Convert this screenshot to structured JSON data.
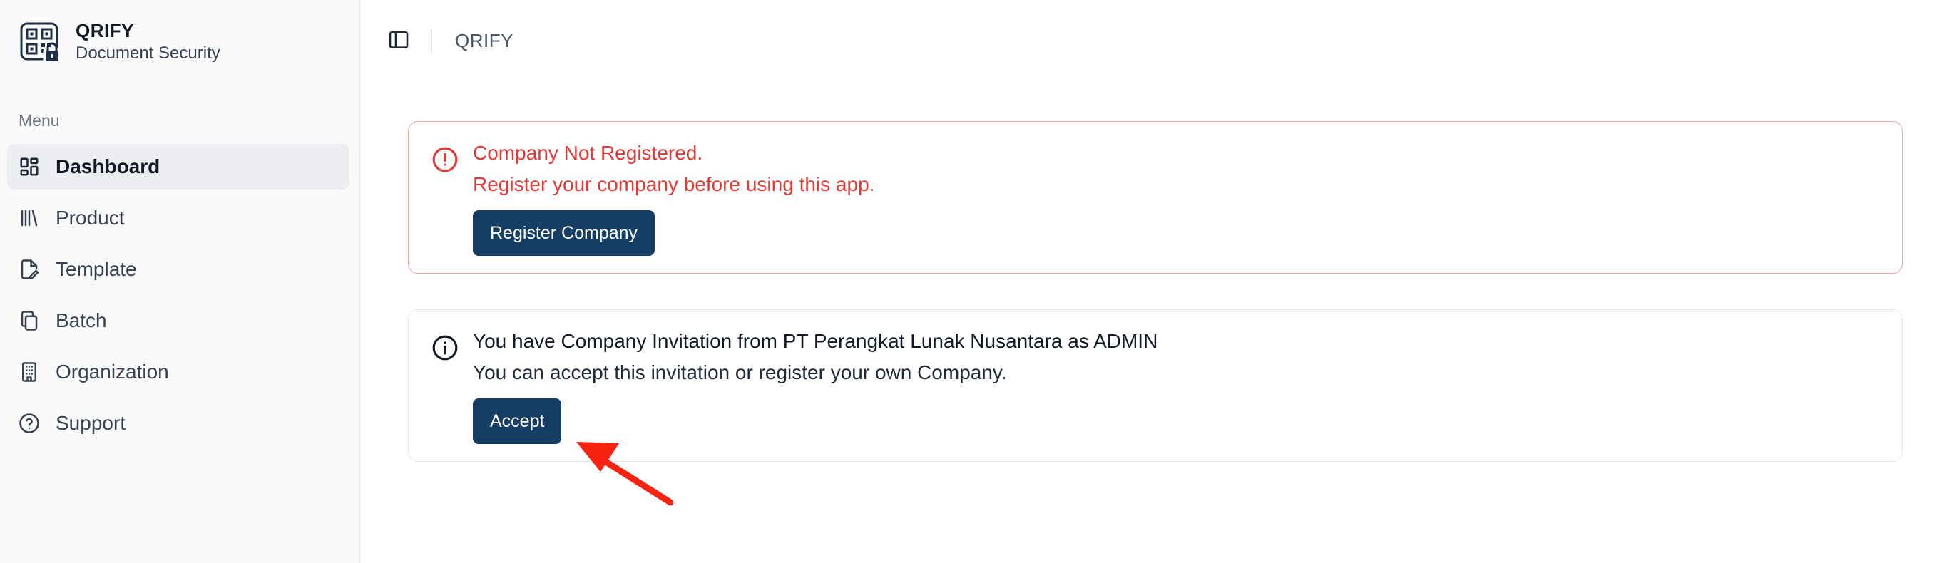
{
  "brand": {
    "title": "QRIFY",
    "subtitle": "Document Security",
    "logo_icon": "qr-lock-icon"
  },
  "sidebar": {
    "menu_label": "Menu",
    "items": [
      {
        "label": "Dashboard",
        "icon": "dashboard-icon",
        "active": true
      },
      {
        "label": "Product",
        "icon": "library-icon",
        "active": false
      },
      {
        "label": "Template",
        "icon": "file-edit-icon",
        "active": false
      },
      {
        "label": "Batch",
        "icon": "copy-icon",
        "active": false
      },
      {
        "label": "Organization",
        "icon": "building-icon",
        "active": false
      },
      {
        "label": "Support",
        "icon": "help-circle-icon",
        "active": false
      }
    ]
  },
  "topbar": {
    "toggle_icon": "sidebar-toggle-icon",
    "breadcrumb": "QRIFY"
  },
  "alerts": {
    "not_registered": {
      "icon": "alert-circle-icon",
      "title": "Company Not Registered.",
      "description": "Register your company before using this app.",
      "button": "Register Company",
      "color": "#e53935"
    },
    "invitation": {
      "icon": "info-icon",
      "title": "You have Company Invitation from PT Perangkat Lunak Nusantara as ADMIN",
      "description": "You can accept this invitation or register your own Company.",
      "button": "Accept"
    }
  },
  "colors": {
    "primary_button": "#163d63",
    "danger": "#e53935",
    "annotation_arrow": "#f5230f"
  }
}
